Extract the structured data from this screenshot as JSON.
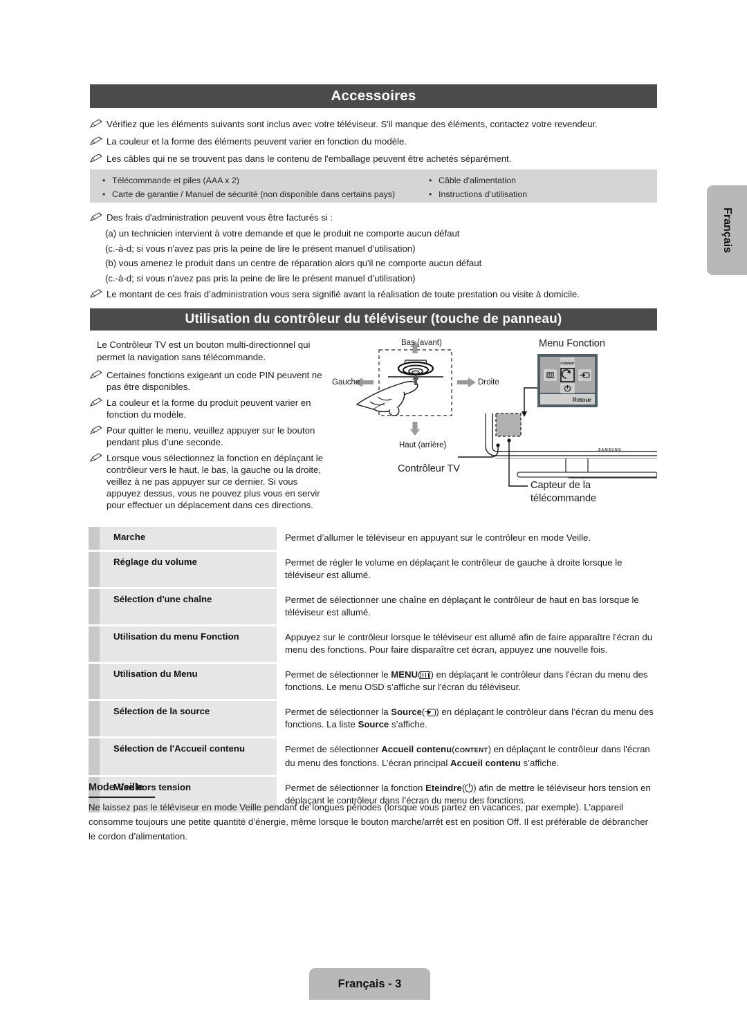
{
  "sections": {
    "accessoires": {
      "banner_title": "Accessoires",
      "notes": [
        "Vérifiez que les éléments suivants sont inclus avec votre téléviseur. S'il manque des éléments, contactez votre revendeur.",
        "La couleur et la forme des éléments peuvent varier en fonction du modèle.",
        "Les câbles qui ne se trouvent pas dans le contenu de l'emballage peuvent être achetés séparément."
      ],
      "items_left": [
        "Télécommande et piles (AAA x 2)",
        "Carte de garantie / Manuel de sécurité (non disponible dans certains pays)"
      ],
      "items_right": [
        "Câble d'alimentation",
        "Instructions d’utilisation"
      ],
      "fees_intro": "Des frais d'administration peuvent vous être facturés si :",
      "fees_lines": [
        "(a) un technicien intervient à votre demande et que le produit ne comporte aucun défaut",
        "(c.-à-d; si vous n'avez pas pris la peine de lire le présent manuel d'utilisation)",
        "(b) vous amenez le produit dans un centre de réparation alors qu'il ne comporte aucun défaut",
        "(c.-à-d; si vous n'avez pas pris la peine de lire le présent manuel d'utilisation)"
      ],
      "fees_outro": "Le montant de ces frais d’administration vous sera signifié avant la réalisation de toute prestation ou visite à domicile."
    },
    "controleur": {
      "banner_title": "Utilisation du contrôleur du téléviseur (touche de panneau)",
      "intro": "Le Contrôleur TV est un bouton multi-directionnel qui permet la navigation sans télécommande.",
      "notes": [
        "Certaines fonctions exigeant un code PIN peuvent ne pas être disponibles.",
        "La couleur et la forme du produit peuvent varier en fonction du modèle.",
        "Pour quitter le menu, veuillez appuyer sur le bouton pendant plus d’une seconde.",
        "Lorsque vous sélectionnez la fonction en déplaçant le contrôleur vers le haut, le bas, la gauche ou la droite, veillez à ne pas appuyer sur ce dernier. Si vous appuyez dessus, vous ne pouvez plus vous en servir pour effectuer un déplacement dans ces directions."
      ],
      "diagram": {
        "label_up": "Bas (avant)",
        "label_down": "Haut (arrière)",
        "label_left": "Gauche",
        "label_right": "Droite",
        "label_menu": "Menu Fonction",
        "label_controller": "Contrôleur TV",
        "label_sensor": "Capteur de la télécommande",
        "menu_return": "Retour",
        "menu_content": "CONTENT",
        "brand": "SAMSUNG"
      },
      "functions": [
        {
          "label": "Marche",
          "desc_html": "Permet d’allumer le téléviseur en appuyant sur le contrôleur en mode Veille."
        },
        {
          "label": "Réglage du volume",
          "desc_html": "Permet de régler le volume en déplaçant le contrôleur de gauche à droite lorsque le téléviseur est allumé."
        },
        {
          "label": "Sélection d'une chaîne",
          "desc_html": "Permet de sélectionner une chaîne en déplaçant le contrôleur de haut en bas lorsque le téléviseur est allumé."
        },
        {
          "label": "Utilisation du menu Fonction",
          "desc_html": "Appuyez sur le contrôleur lorsque le téléviseur est allumé afin de faire apparaître l'écran du menu des fonctions. Pour faire disparaître cet écran, appuyez une nouvelle fois."
        },
        {
          "label": "Utilisation du Menu",
          "desc_html": "Permet de sélectionner le <b>MENU</b>(<span class=\"ic ic-menu\"><i></i><i></i><i></i></span>) en déplaçant le contrôleur dans l'écran du menu des fonctions. Le menu OSD s’affiche sur l'écran du téléviseur."
        },
        {
          "label": "Sélection de la source",
          "desc_html": "Permet de sélectionner la <b>Source</b>(<span class=\"ic ic-source\"><span class=\"bx\"></span><span class=\"ar\"></span><span class=\"ah\"></span></span>) en déplaçant le contrôleur dans l’écran du menu des fonctions. La liste <b>Source</b> s’affiche."
        },
        {
          "label": "Sélection de l'Accueil contenu",
          "desc_html": "Permet de sélectionner <b>Accueil contenu</b>(<span class=\"small-caps\">CONTENT</span>) en déplaçant le contrôleur dans l'écran du menu des fonctions. L’écran principal <b>Accueil contenu</b> s’affiche."
        },
        {
          "label": "Mise hors tension",
          "desc_html": "Permet de sélectionner la fonction <b>Eteindre</b>(<span class=\"ic ic-power\"></span>) afin de mettre le téléviseur hors tension en déplaçant le contrôleur dans l’écran du menu des fonctions."
        }
      ]
    },
    "mode_veille": {
      "title": "Mode Veille",
      "body": "Ne laissez pas le téléviseur en mode Veille pendant de longues périodes (lorsque vous partez en vacances, par exemple). L'appareil consomme toujours une petite quantité d’énergie, même lorsque le bouton marche/arrêt est en position Off. Il est préférable de débrancher le cordon d’alimentation."
    }
  },
  "side_tab": {
    "label": "Français"
  },
  "footer": {
    "label": "Français - 3"
  },
  "colors": {
    "banner_bg": "#4b4b4b",
    "accessory_box_bg": "#d5d5d5",
    "row_label_bg": "#e6e6e6",
    "row_stripe_bg": "#c9c9c9",
    "tab_bg": "#b8b8b8"
  }
}
